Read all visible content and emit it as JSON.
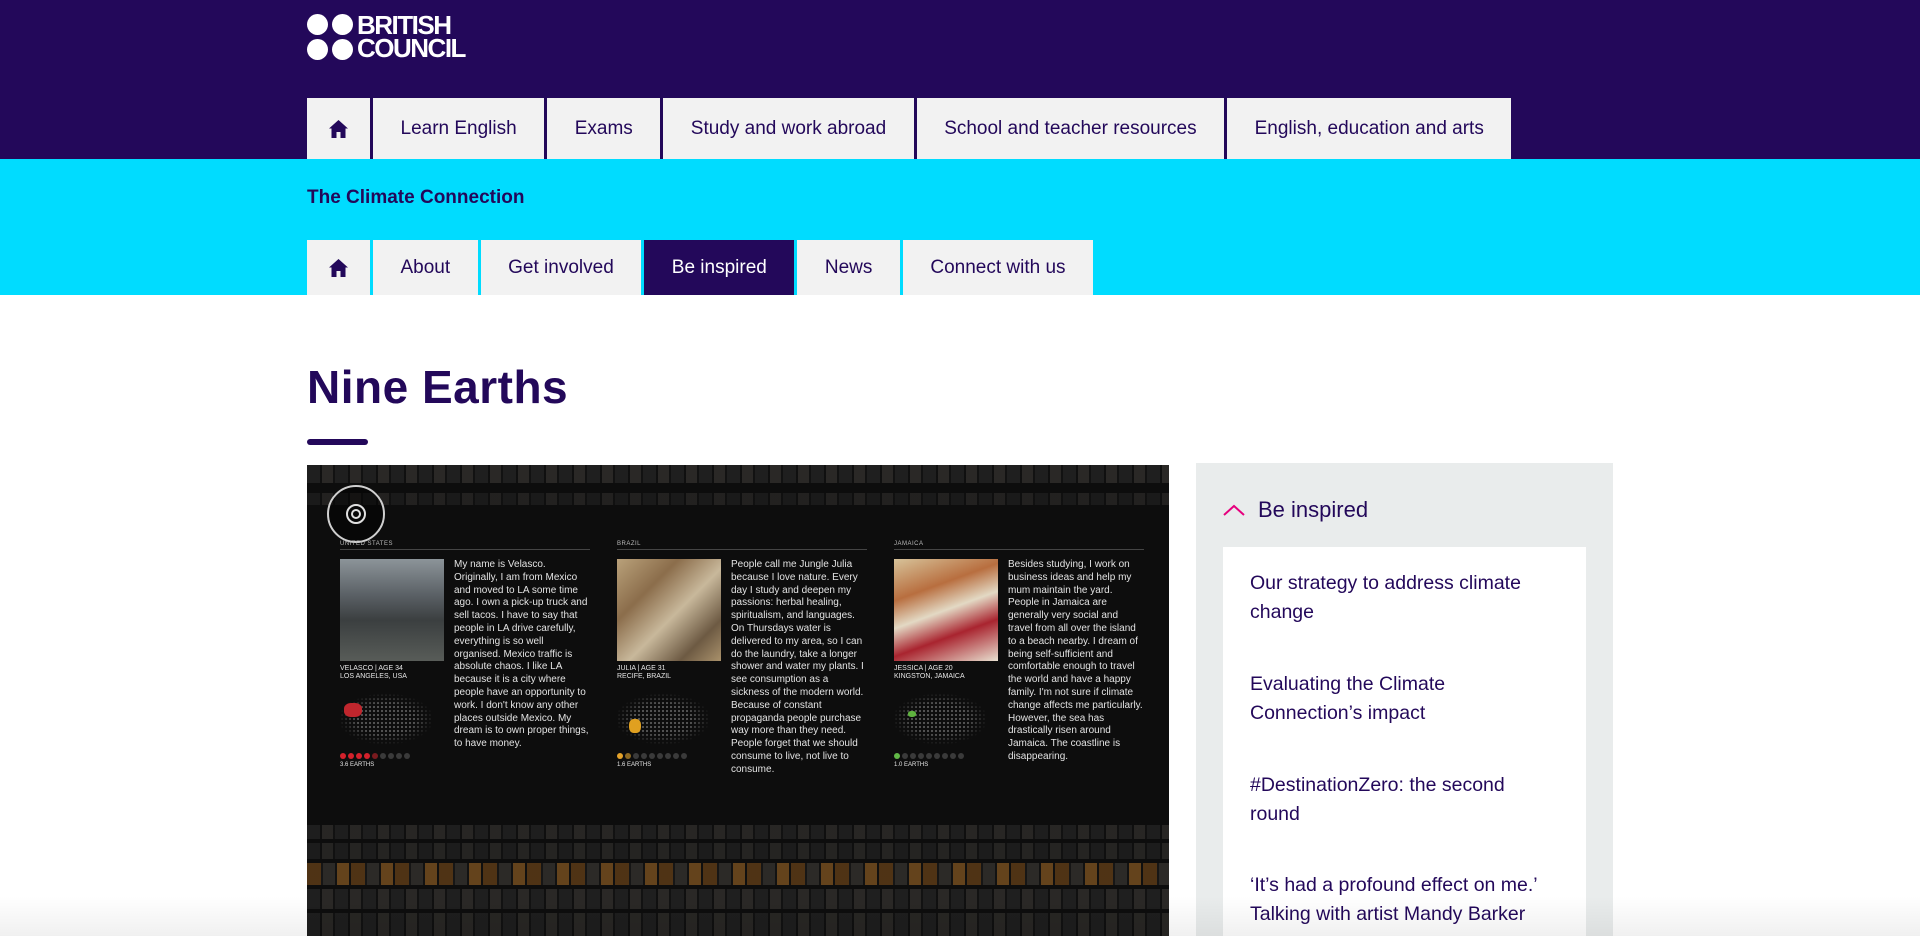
{
  "brand": {
    "logo_line1": "BRITISH",
    "logo_line2": "COUNCIL"
  },
  "main_nav": {
    "home_icon": "home-icon",
    "items": [
      {
        "label": "Learn English"
      },
      {
        "label": "Exams"
      },
      {
        "label": "Study and work abroad"
      },
      {
        "label": "School and teacher resources"
      },
      {
        "label": "English, education and arts"
      }
    ]
  },
  "section": {
    "title": "The Climate Connection",
    "home_icon": "home-icon",
    "nav": [
      {
        "label": "About",
        "active": false
      },
      {
        "label": "Get involved",
        "active": false
      },
      {
        "label": "Be inspired",
        "active": true
      },
      {
        "label": "News",
        "active": false
      },
      {
        "label": "Connect with us",
        "active": false
      }
    ]
  },
  "page": {
    "title": "Nine Earths"
  },
  "feature_image": {
    "play_icon": "target-play-icon",
    "profiles": [
      {
        "country": "UNITED STATES",
        "caption_name": "VELASCO | AGE 34",
        "caption_place": "LOS ANGELES, USA",
        "earths": "3.6 EARTHS",
        "bio": "My name is Velasco. Originally, I am from Mexico and moved to LA some time ago. I own a pick-up truck and sell tacos. I have to say that people in LA drive carefully, everything is so well organised. Mexico traffic is absolute chaos. I like LA because it is a city where people have an opportunity to work. I don't know any other places outside Mexico. My dream is to own proper things, to have money."
      },
      {
        "country": "BRAZIL",
        "caption_name": "JULIA | AGE 31",
        "caption_place": "RECIFE, BRAZIL",
        "earths": "1.6 EARTHS",
        "bio": "People call me Jungle Julia because I love nature. Every day I study and deepen my passions: herbal healing, spiritualism, and languages. On Thursdays water is delivered to my area, so I can do the laundry, take a longer shower and water my plants. I see consumption as a sickness of the modern world. Because of constant propaganda people purchase way more than they need. People forget that we should consume to live, not live to consume."
      },
      {
        "country": "JAMAICA",
        "caption_name": "JESSICA | AGE 20",
        "caption_place": "KINGSTON, JAMAICA",
        "earths": "1.0 EARTHS",
        "bio": "Besides studying, I work on business ideas and help my mum maintain the yard. People in Jamaica are generally very social and travel from all over the island to a beach nearby. I dream of being self-sufficient and comfortable enough to travel the world and have a happy family. I'm not sure if climate change affects me particularly. However, the sea has drastically risen around Jamaica. The coastline is disappearing."
      }
    ]
  },
  "sidebar": {
    "toggle_icon": "chevron-up-icon",
    "title": "Be inspired",
    "links": [
      {
        "label": "Our strategy to address climate change"
      },
      {
        "label": "Evaluating the Climate Connection’s impact"
      },
      {
        "label": "#DestinationZero: the second round"
      },
      {
        "label": "‘It’s had a profound effect on me.’ Talking with artist Mandy Barker"
      }
    ]
  },
  "colors": {
    "brand_purple": "#23085a",
    "cyan": "#00dcff",
    "nav_bg": "#f2f2f2",
    "sidebar_bg": "#e9ecec",
    "accent_magenta": "#e6007e"
  }
}
